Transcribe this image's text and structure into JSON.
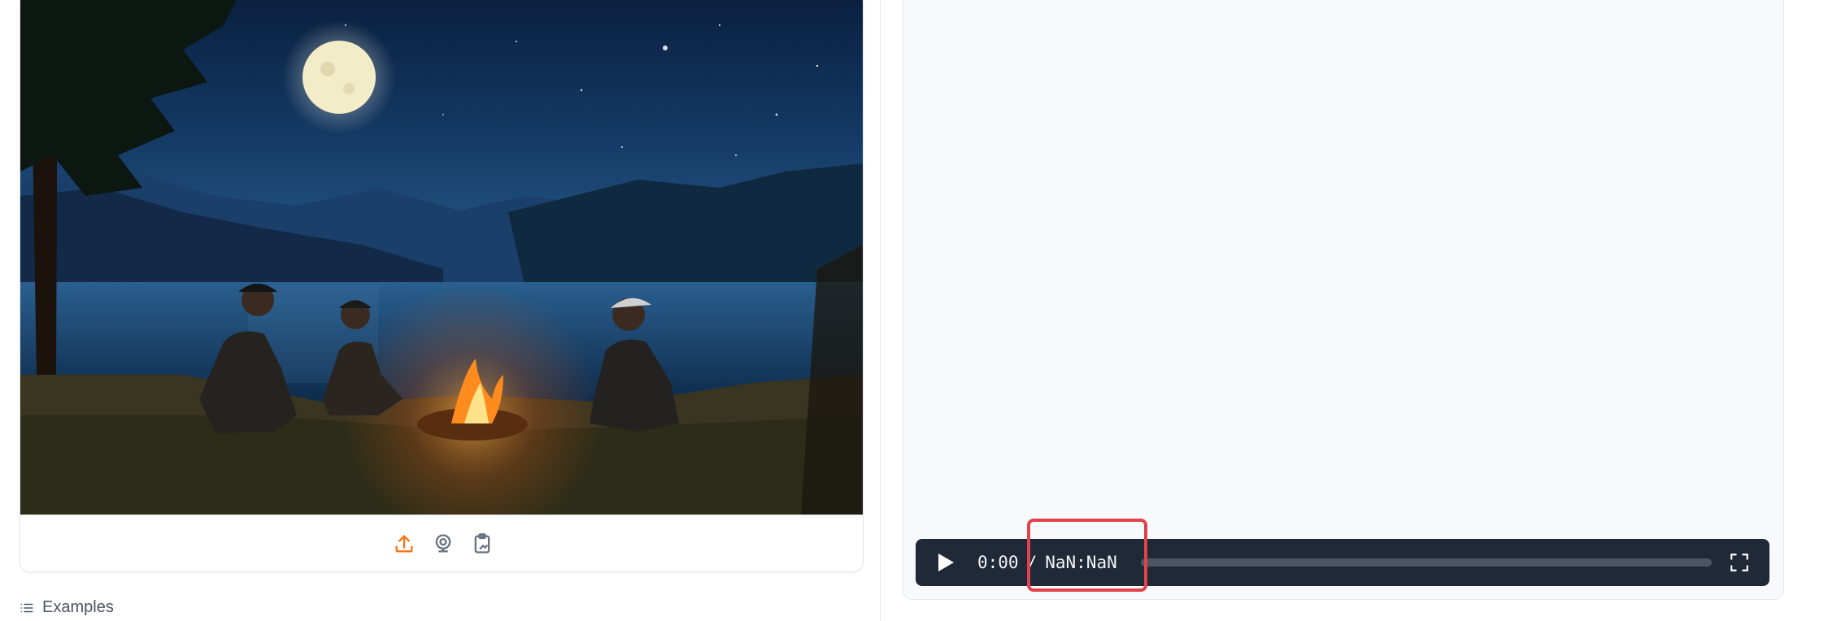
{
  "image_input": {
    "scene_description_icon": "campfire-lake-night-image",
    "source_buttons": [
      {
        "icon": "upload-icon",
        "color": "#f97316"
      },
      {
        "icon": "webcam-icon",
        "color": "#6b7280"
      },
      {
        "icon": "clipboard-icon",
        "color": "#6b7280"
      }
    ]
  },
  "examples": {
    "label": "Examples",
    "icon": "list-icon"
  },
  "video_player": {
    "current_time": "0:00",
    "separator": "/",
    "duration": "NaN:NaN",
    "progress": 0,
    "play_icon": "play-icon",
    "fullscreen_icon": "fullscreen-icon"
  },
  "colors": {
    "accent": "#f97316",
    "controls_bg": "#1f2937",
    "highlight": "#e0434b"
  }
}
